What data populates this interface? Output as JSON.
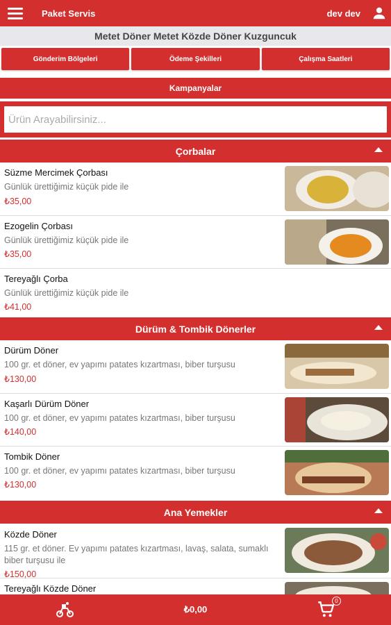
{
  "header": {
    "title": "Paket Servis",
    "user_name": "dev dev"
  },
  "restaurant": {
    "name": "Metet Döner Metet Közde Döner Kuzguncuk"
  },
  "info_buttons": [
    "Gönderim Bölgeleri",
    "Ödeme Şekilleri",
    "Çalışma Saatleri"
  ],
  "campaign_label": "Kampanyalar",
  "search": {
    "placeholder": "Ürün Arayabilirsiniz..."
  },
  "categories": [
    {
      "name": "Çorbalar",
      "products": [
        {
          "name": "Süzme Mercimek Çorbası",
          "description": "Günlük ürettiğimiz küçük pide ile",
          "price": "₺35,00"
        },
        {
          "name": "Ezogelin Çorbası",
          "description": "Günlük ürettiğimiz küçük pide ile",
          "price": "₺35,00"
        },
        {
          "name": "Tereyağlı Çorba",
          "description": "Günlük ürettiğimiz küçük pide ile",
          "price": "₺41,00"
        }
      ]
    },
    {
      "name": "Dürüm & Tombik Dönerler",
      "products": [
        {
          "name": "Dürüm Döner",
          "description": "100 gr. et döner, ev yapımı patates kızartması, biber turşusu",
          "price": "₺130,00"
        },
        {
          "name": "Kaşarlı Dürüm Döner",
          "description": "100 gr. et döner, ev yapımı patates kızartması, biber turşusu",
          "price": "₺140,00"
        },
        {
          "name": "Tombik Döner",
          "description": "100 gr. et döner, ev yapımı patates kızartması, biber turşusu",
          "price": "₺130,00"
        }
      ]
    },
    {
      "name": "Ana Yemekler",
      "products": [
        {
          "name": "Közde Döner",
          "description": "115 gr. et döner. Ev yapımı patates kızartması, lavaş, salata, sumaklı biber turşusu ile",
          "price": "₺150,00"
        },
        {
          "name": "Tereyağlı Közde Döner",
          "description": "",
          "price": ""
        }
      ]
    }
  ],
  "footer": {
    "total": "₺0,00",
    "cart_count": "0"
  },
  "colors": {
    "primary": "#d32f2f",
    "price": "#d32f2f",
    "background": "#ffffff"
  }
}
